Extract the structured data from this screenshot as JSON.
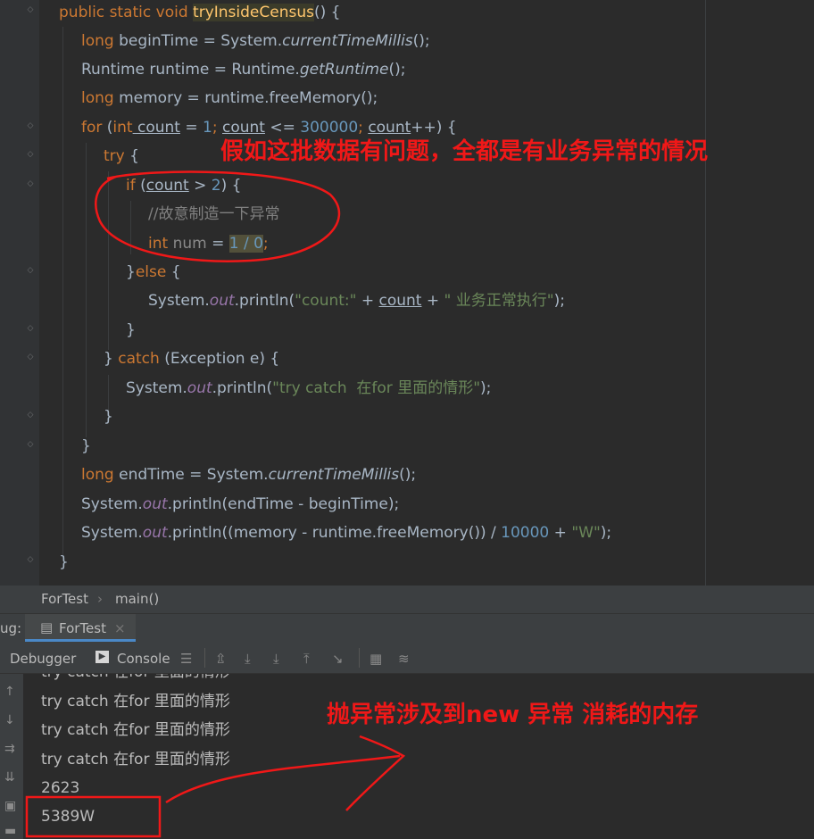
{
  "code": {
    "method_sig": {
      "public": "public",
      "static": "static",
      "void": "void",
      "name": "tryInsideCensus",
      "rest": "() {"
    },
    "l2": {
      "type": "long",
      "a": " beginTime = System.",
      "m": "currentTimeMillis",
      "b": "();"
    },
    "l3": {
      "a": "Runtime runtime = Runtime.",
      "m": "getRuntime",
      "b": "();"
    },
    "l4": {
      "type": "long",
      "a": " memory = runtime.freeMemory();"
    },
    "l5": {
      "for": "for",
      "p1": " (",
      "int": "int",
      "v1": " count",
      "eq": " = ",
      "n1": "1",
      "semi1": "; ",
      "v2": "count",
      "op": " <= ",
      "n2": "300000",
      "semi2": "; ",
      "v3": "count",
      "end": "++) {"
    },
    "l6": {
      "try": "try",
      "b": " {"
    },
    "l7": {
      "if": "if",
      "a": " (",
      "v": "count",
      "b": " > ",
      "n": "2",
      "c": ") {"
    },
    "l8": {
      "comment": "//故意制造一下异常"
    },
    "l9": {
      "int": "int",
      "v": " num",
      "eq": " = ",
      "expr": "1 / 0",
      "semi": ";"
    },
    "l10": {
      "a": "}",
      "else": "else",
      "b": " {"
    },
    "l11": {
      "a": "System.",
      "out": "out",
      "b": ".println(",
      "s1": "\"count:\"",
      "c": " + ",
      "v": "count",
      "d": " + ",
      "s2": "\" 业务正常执行\"",
      "e": ");"
    },
    "l12": {
      "a": "}"
    },
    "l13": {
      "a": "} ",
      "catch": "catch",
      "b": " (Exception e) {"
    },
    "l14": {
      "a": "System.",
      "out": "out",
      "b": ".println(",
      "s": "\"try catch  在for 里面的情形\"",
      "c": ");"
    },
    "l15": {
      "a": "}"
    },
    "l16": {
      "a": "}"
    },
    "l17": {
      "type": "long",
      "a": " endTime = System.",
      "m": "currentTimeMillis",
      "b": "();"
    },
    "l18": {
      "a": "System.",
      "out": "out",
      "b": ".println(endTime - beginTime);"
    },
    "l19": {
      "a": "System.",
      "out": "out",
      "b": ".println((memory - runtime.freeMemory()) / ",
      "n": "10000",
      "c": " + ",
      "s": "\"W\"",
      "d": ");"
    },
    "l20": {
      "a": "}"
    }
  },
  "annotations": {
    "top_note": "假如这批数据有问题，全都是有业务异常的情况",
    "bottom_note": "抛异常涉及到new 异常 消耗的内存",
    "color": "#f01818"
  },
  "breadcrumb": {
    "class_name": "ForTest",
    "method_name": "main()"
  },
  "debug_panel": {
    "label": "ug:",
    "run_tab": "ForTest",
    "close_glyph": "×",
    "debugger_tab": "Debugger",
    "console_tab": "Console"
  },
  "console": {
    "lines": [
      "try catch  在for 里面的情形",
      "try catch  在for 里面的情形",
      "try catch  在for 里面的情形",
      "try catch  在for 里面的情形",
      "2623",
      "5389W"
    ]
  },
  "colors": {
    "keyword": "#cc7832",
    "method": "#ffc66d",
    "string": "#6a8759",
    "number": "#6897bb",
    "field": "#9876aa",
    "background": "#2b2b2b"
  }
}
